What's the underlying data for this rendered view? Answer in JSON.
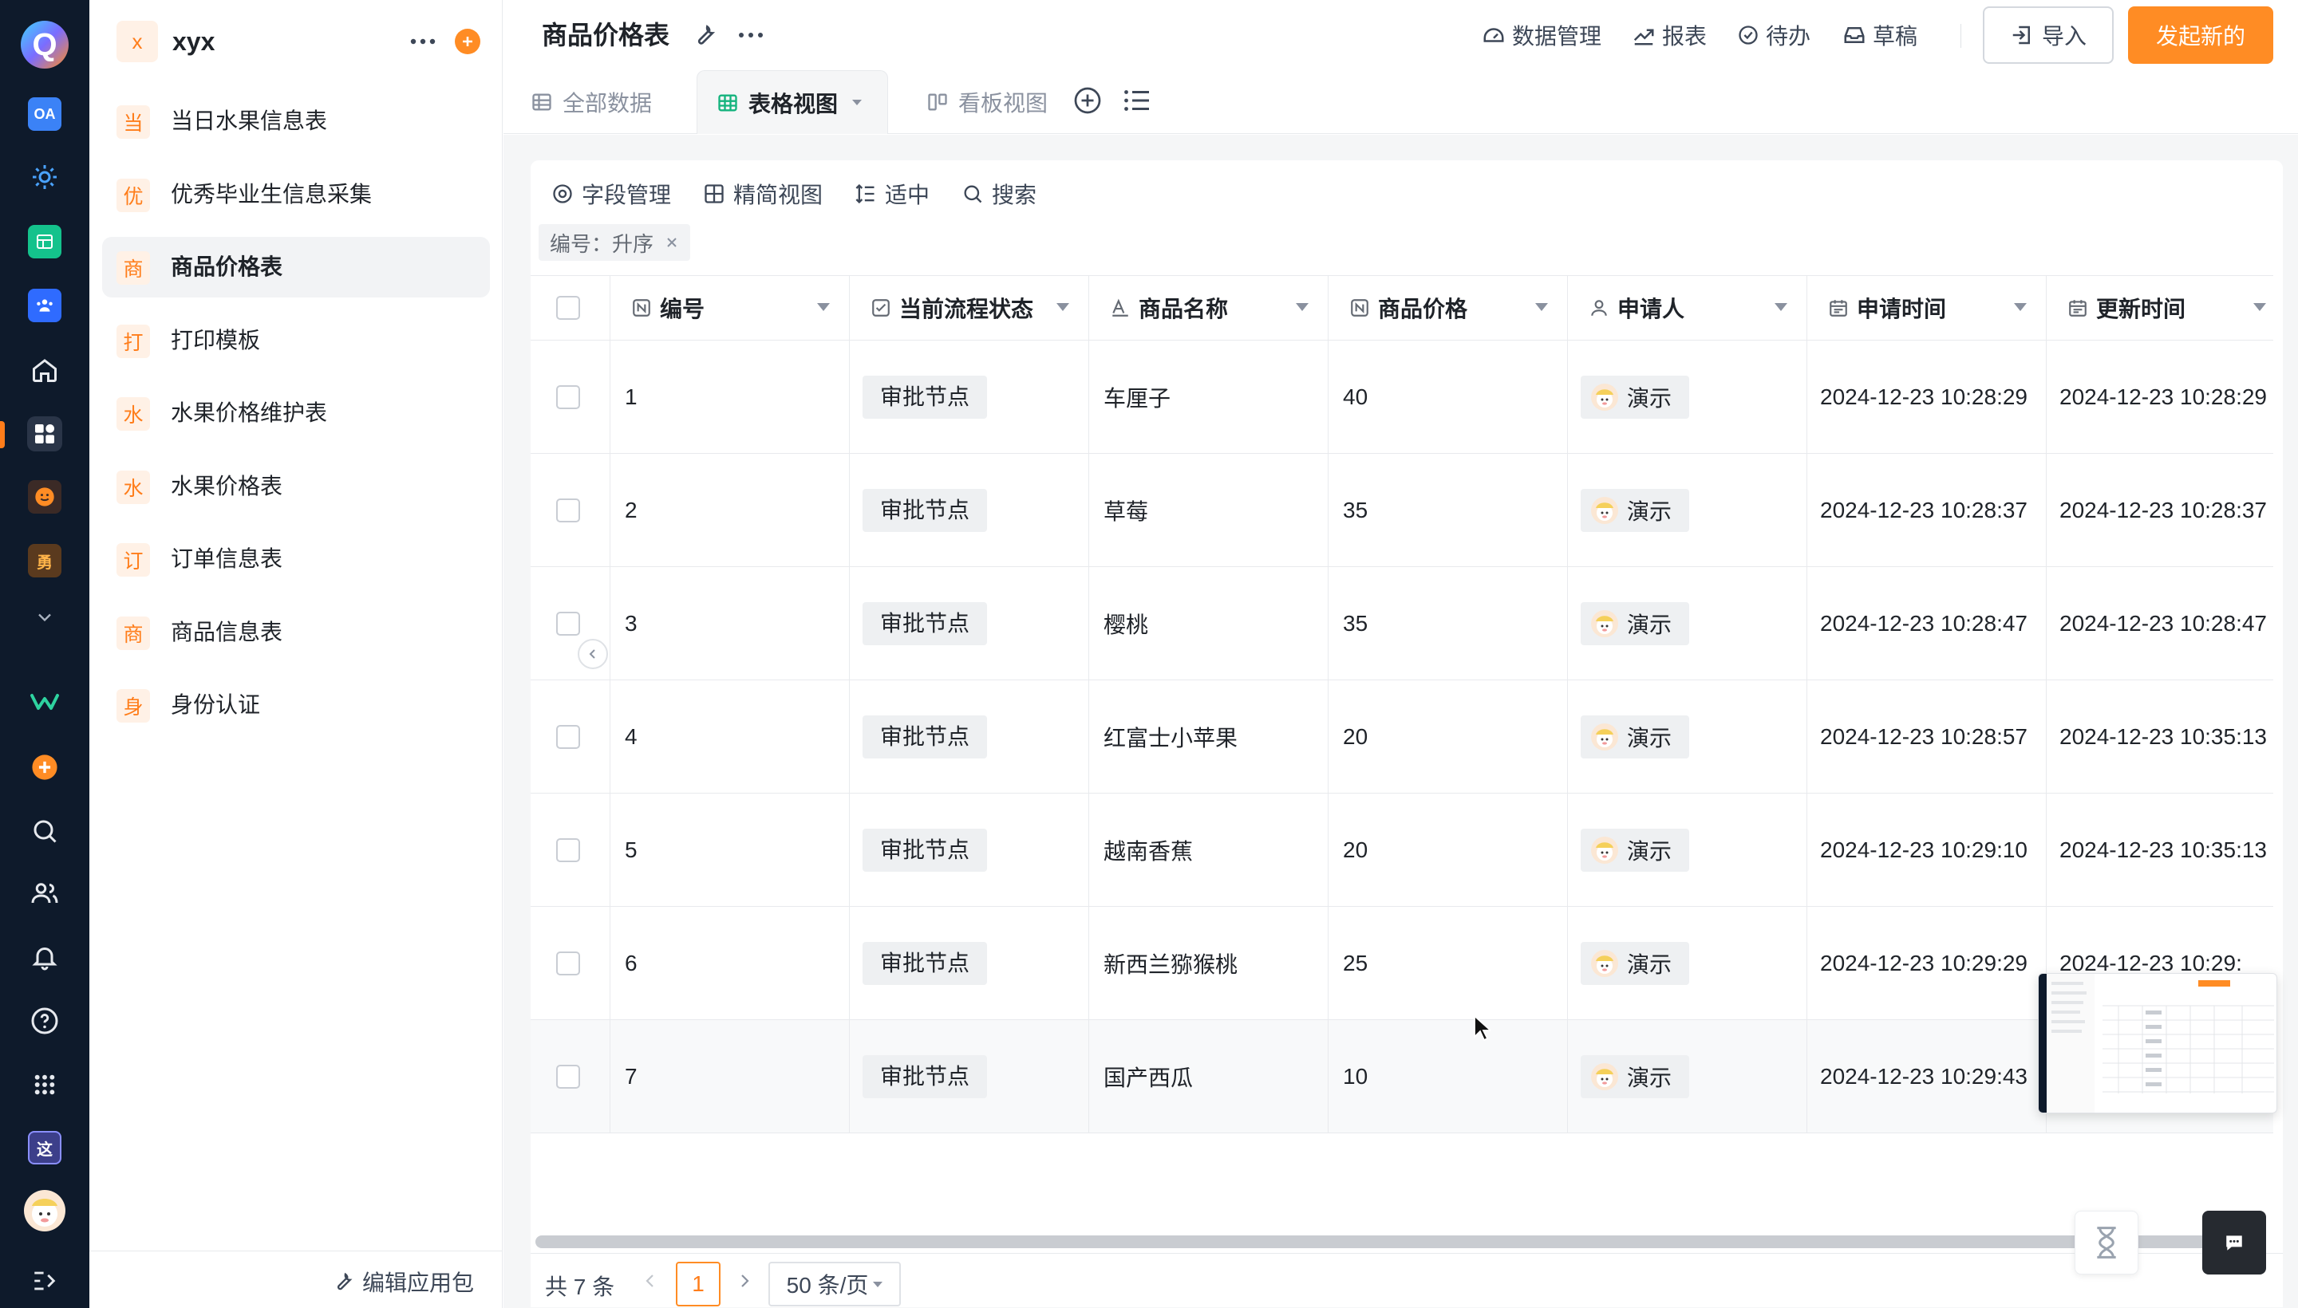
{
  "rail": {
    "logo_letter": "Q",
    "oa_label": "OA",
    "yong_label": "勇",
    "zhe_label": "这",
    "icons": [
      "oa-icon",
      "settings-gear-icon",
      "sheet-app-icon",
      "team-icon",
      "home-icon",
      "apps-grid-icon",
      "emoji-icon",
      "yong-app-icon",
      "chevron-down-icon",
      "brand-w-icon",
      "add-icon",
      "search-icon",
      "contacts-icon",
      "bell-icon",
      "help-icon",
      "dots-grid-icon",
      "zhe-app-icon",
      "avatar",
      "expand-icon"
    ]
  },
  "sidebar": {
    "workspace_letter": "x",
    "workspace_name": "xyx",
    "items": [
      {
        "badge": "当",
        "label": "当日水果信息表"
      },
      {
        "badge": "优",
        "label": "优秀毕业生信息采集"
      },
      {
        "badge": "商",
        "label": "商品价格表"
      },
      {
        "badge": "打",
        "label": "打印模板"
      },
      {
        "badge": "水",
        "label": "水果价格维护表"
      },
      {
        "badge": "水",
        "label": "水果价格表"
      },
      {
        "badge": "订",
        "label": "订单信息表"
      },
      {
        "badge": "商",
        "label": "商品信息表"
      },
      {
        "badge": "身",
        "label": "身份认证"
      }
    ],
    "active_index": 2,
    "edit_package": "编辑应用包"
  },
  "header": {
    "title": "商品价格表",
    "data_manage": "数据管理",
    "report": "报表",
    "todo": "待办",
    "draft": "草稿",
    "import": "导入",
    "start_new": "发起新的",
    "tabs": [
      {
        "label": "全部数据",
        "icon": "table-icon"
      },
      {
        "label": "表格视图",
        "icon": "grid-table-icon",
        "active": true
      },
      {
        "label": "看板视图",
        "icon": "kanban-icon"
      }
    ]
  },
  "toolbar": {
    "field_manage": "字段管理",
    "compact_view": "精简视图",
    "row_height": "适中",
    "search": "搜索",
    "sort_chip": "编号：升序"
  },
  "table": {
    "columns": [
      {
        "label": "编号",
        "icon": "number-field-icon"
      },
      {
        "label": "当前流程状态",
        "icon": "checkbox-field-icon"
      },
      {
        "label": "商品名称",
        "icon": "text-field-icon"
      },
      {
        "label": "商品价格",
        "icon": "number-field-icon"
      },
      {
        "label": "申请人",
        "icon": "person-field-icon"
      },
      {
        "label": "申请时间",
        "icon": "date-field-icon"
      },
      {
        "label": "更新时间",
        "icon": "date-field-icon"
      }
    ],
    "rows": [
      {
        "id": "1",
        "status": "审批节点",
        "name": "车厘子",
        "price": "40",
        "applicant": "演示",
        "applied": "2024-12-23 10:28:29",
        "updated": "2024-12-23 10:28:29"
      },
      {
        "id": "2",
        "status": "审批节点",
        "name": "草莓",
        "price": "35",
        "applicant": "演示",
        "applied": "2024-12-23 10:28:37",
        "updated": "2024-12-23 10:28:37"
      },
      {
        "id": "3",
        "status": "审批节点",
        "name": "樱桃",
        "price": "35",
        "applicant": "演示",
        "applied": "2024-12-23 10:28:47",
        "updated": "2024-12-23 10:28:47"
      },
      {
        "id": "4",
        "status": "审批节点",
        "name": "红富士小苹果",
        "price": "20",
        "applicant": "演示",
        "applied": "2024-12-23 10:28:57",
        "updated": "2024-12-23 10:35:13"
      },
      {
        "id": "5",
        "status": "审批节点",
        "name": "越南香蕉",
        "price": "20",
        "applicant": "演示",
        "applied": "2024-12-23 10:29:10",
        "updated": "2024-12-23 10:35:13"
      },
      {
        "id": "6",
        "status": "审批节点",
        "name": "新西兰猕猴桃",
        "price": "25",
        "applicant": "演示",
        "applied": "2024-12-23 10:29:29",
        "updated": "2024-12-23 10:29:"
      },
      {
        "id": "7",
        "status": "审批节点",
        "name": "国产西瓜",
        "price": "10",
        "applicant": "演示",
        "applied": "2024-12-23 10:29:43",
        "updated": ""
      }
    ]
  },
  "pager": {
    "total": "共 7 条",
    "current": "1",
    "page_size": "50 条/页"
  },
  "colors": {
    "accent": "#ff8c24",
    "rail_bg": "#0e1a2b",
    "badge_bg": "#fff1e6"
  }
}
